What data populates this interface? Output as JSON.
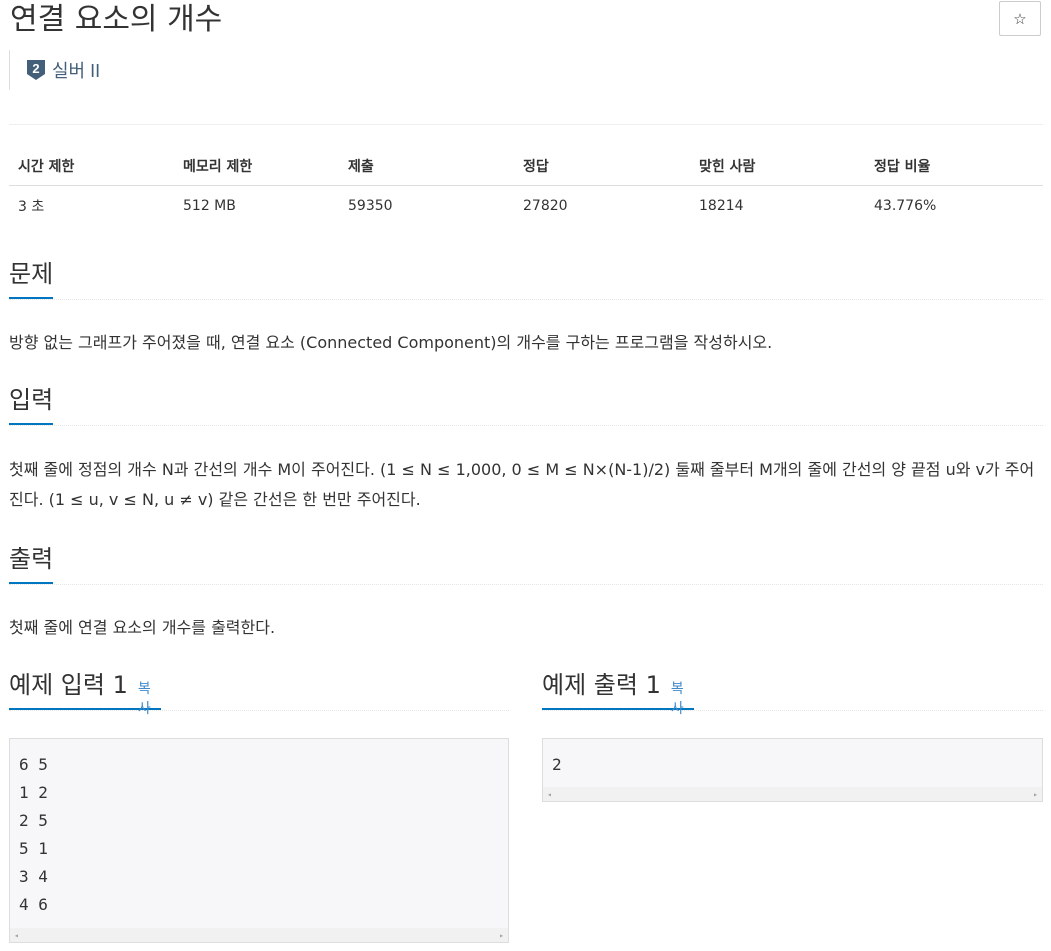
{
  "page": {
    "title": "연결 요소의 개수",
    "star_glyph": "☆",
    "tier": {
      "level": "2",
      "label": "실버 II",
      "badge_color": "#435f7a"
    }
  },
  "info_table": {
    "headers": [
      "시간 제한",
      "메모리 제한",
      "제출",
      "정답",
      "맞힌 사람",
      "정답 비율"
    ],
    "values": [
      "3 초",
      "512 MB",
      "59350",
      "27820",
      "18214",
      "43.776%"
    ]
  },
  "sections": {
    "problem": {
      "title": "문제",
      "body": "방향 없는 그래프가 주어졌을 때, 연결 요소 (Connected Component)의 개수를 구하는 프로그램을 작성하시오."
    },
    "input": {
      "title": "입력",
      "body": "첫째 줄에 정점의 개수 N과 간선의 개수 M이 주어진다. (1 ≤ N ≤ 1,000, 0 ≤ M ≤ N×(N-1)/2) 둘째 줄부터 M개의 줄에 간선의 양 끝점 u와 v가 주어진다. (1 ≤ u, v ≤ N, u ≠ v) 같은 간선은 한 번만 주어진다."
    },
    "output": {
      "title": "출력",
      "body": "첫째 줄에 연결 요소의 개수를 출력한다."
    }
  },
  "samples": {
    "input_title": "예제 입력 1",
    "output_title": "예제 출력 1",
    "copy_label": "복사",
    "input_text": "6 5\n1 2\n2 5\n5 1\n3 4\n4 6",
    "output_text": "2",
    "scroll_left": "◂",
    "scroll_right": "▸"
  },
  "colors": {
    "accent": "#0076c0",
    "link": "#428bca"
  }
}
